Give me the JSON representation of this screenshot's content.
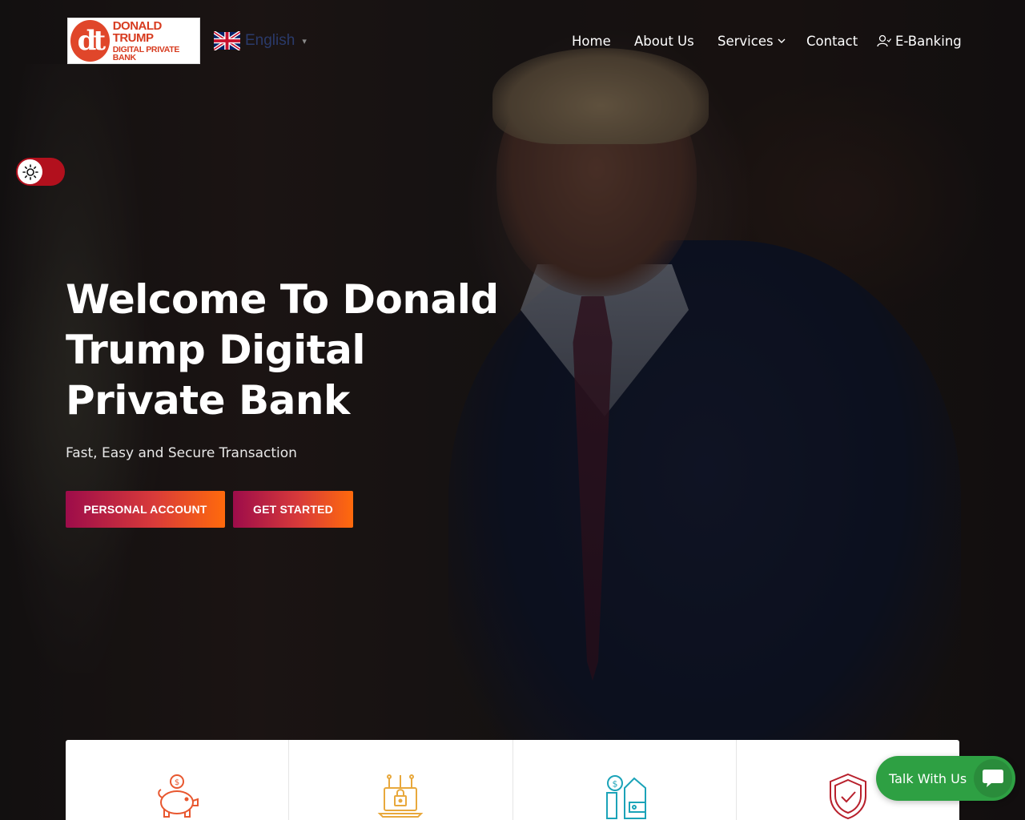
{
  "brand": {
    "logo_mark": "dt",
    "logo_line1": "DONALD TRUMP",
    "logo_line2": "DIGITAL PRIVATE BANK"
  },
  "language": {
    "label": "English",
    "caret": "▾",
    "flag_icon": "uk-flag-icon"
  },
  "nav": {
    "items": [
      {
        "label": "Home"
      },
      {
        "label": "About Us"
      },
      {
        "label": "Services",
        "icon": "chevron-down-icon"
      },
      {
        "label": "Contact"
      },
      {
        "label": "E-Banking",
        "icon": "user-icon"
      }
    ]
  },
  "theme_toggle": {
    "icon": "sun-icon",
    "color": "#b2101d"
  },
  "hero": {
    "title": "Welcome To Donald Trump Digital Private Bank",
    "subtitle": "Fast, Easy and Secure Transaction",
    "buttons": [
      {
        "label": "PERSONAL ACCOUNT"
      },
      {
        "label": "GET STARTED"
      }
    ],
    "button_gradient": [
      "#9d0c4a",
      "#ff6a0c"
    ]
  },
  "features": {
    "icons": [
      "piggy-bank-icon",
      "secure-laptop-icon",
      "wallet-icon",
      "shield-check-icon"
    ],
    "icon_colors": [
      "#e8572f",
      "#e8a83c",
      "#1ba3b8",
      "#b8202c"
    ]
  },
  "chat": {
    "label": "Talk With Us",
    "icon": "chat-bubble-icon",
    "color": "#2ea043"
  }
}
